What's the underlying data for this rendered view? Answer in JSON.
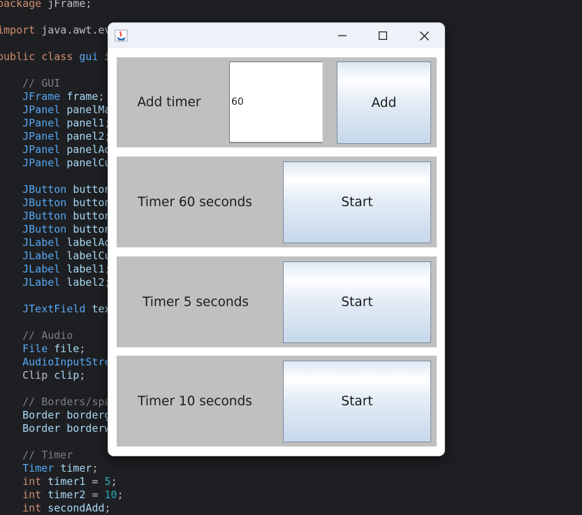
{
  "editor": {
    "lines": [
      [
        [
          "kw",
          "package"
        ],
        [
          "pl",
          " jFrame;"
        ]
      ],
      [],
      [
        [
          "kw",
          "import"
        ],
        [
          "pl",
          " java.awt.ev"
        ]
      ],
      [],
      [
        [
          "kw",
          "public class"
        ],
        [
          "pl",
          " "
        ],
        [
          "ty",
          "gui"
        ],
        [
          "pl",
          " i"
        ]
      ],
      [],
      [
        [
          "pl",
          "    "
        ],
        [
          "cm",
          "// GUI"
        ]
      ],
      [
        [
          "pl",
          "    "
        ],
        [
          "ty",
          "JFrame"
        ],
        [
          "pl",
          " "
        ],
        [
          "fd",
          "frame"
        ],
        [
          "pl",
          ";"
        ]
      ],
      [
        [
          "pl",
          "    "
        ],
        [
          "ty",
          "JPanel"
        ],
        [
          "pl",
          " "
        ],
        [
          "fd",
          "panelMa"
        ]
      ],
      [
        [
          "pl",
          "    "
        ],
        [
          "ty",
          "JPanel"
        ],
        [
          "pl",
          " "
        ],
        [
          "fd",
          "panel1"
        ],
        [
          "pl",
          ";"
        ]
      ],
      [
        [
          "pl",
          "    "
        ],
        [
          "ty",
          "JPanel"
        ],
        [
          "pl",
          " "
        ],
        [
          "fd",
          "panel2"
        ],
        [
          "pl",
          ";"
        ]
      ],
      [
        [
          "pl",
          "    "
        ],
        [
          "ty",
          "JPanel"
        ],
        [
          "pl",
          " "
        ],
        [
          "fd",
          "panelAd"
        ]
      ],
      [
        [
          "pl",
          "    "
        ],
        [
          "ty",
          "JPanel"
        ],
        [
          "pl",
          " "
        ],
        [
          "fd",
          "panelCu"
        ]
      ],
      [],
      [
        [
          "pl",
          "    "
        ],
        [
          "ty",
          "JButton"
        ],
        [
          "pl",
          " "
        ],
        [
          "fd",
          "button"
        ]
      ],
      [
        [
          "pl",
          "    "
        ],
        [
          "ty",
          "JButton"
        ],
        [
          "pl",
          " "
        ],
        [
          "fd",
          "button"
        ]
      ],
      [
        [
          "pl",
          "    "
        ],
        [
          "ty",
          "JButton"
        ],
        [
          "pl",
          " "
        ],
        [
          "fd",
          "button"
        ]
      ],
      [
        [
          "pl",
          "    "
        ],
        [
          "ty",
          "JButton"
        ],
        [
          "pl",
          " "
        ],
        [
          "fd",
          "button"
        ]
      ],
      [
        [
          "pl",
          "    "
        ],
        [
          "ty",
          "JLabel"
        ],
        [
          "pl",
          " "
        ],
        [
          "fd",
          "labelAd"
        ]
      ],
      [
        [
          "pl",
          "    "
        ],
        [
          "ty",
          "JLabel"
        ],
        [
          "pl",
          " "
        ],
        [
          "fd",
          "labelCu"
        ]
      ],
      [
        [
          "pl",
          "    "
        ],
        [
          "ty",
          "JLabel"
        ],
        [
          "pl",
          " "
        ],
        [
          "fd",
          "label1"
        ],
        [
          "pl",
          ";"
        ]
      ],
      [
        [
          "pl",
          "    "
        ],
        [
          "ty",
          "JLabel"
        ],
        [
          "pl",
          " "
        ],
        [
          "fd",
          "label2"
        ],
        [
          "pl",
          ";"
        ]
      ],
      [],
      [
        [
          "pl",
          "    "
        ],
        [
          "ty",
          "JTextField"
        ],
        [
          "pl",
          " "
        ],
        [
          "fd",
          "tex"
        ]
      ],
      [],
      [
        [
          "pl",
          "    "
        ],
        [
          "cm",
          "// Audio"
        ]
      ],
      [
        [
          "pl",
          "    "
        ],
        [
          "ty",
          "File"
        ],
        [
          "pl",
          " "
        ],
        [
          "fd",
          "file"
        ],
        [
          "pl",
          ";"
        ]
      ],
      [
        [
          "pl",
          "    "
        ],
        [
          "ty",
          "AudioInputStre"
        ]
      ],
      [
        [
          "pl",
          "    "
        ],
        [
          "pl",
          "Clip "
        ],
        [
          "fd",
          "clip"
        ],
        [
          "pl",
          ";"
        ]
      ],
      [],
      [
        [
          "pl",
          "    "
        ],
        [
          "cm",
          "// Borders/spa"
        ]
      ],
      [
        [
          "pl",
          "    "
        ],
        [
          "fd",
          "Border"
        ],
        [
          "pl",
          " "
        ],
        [
          "fd",
          "borderg"
        ]
      ],
      [
        [
          "pl",
          "    "
        ],
        [
          "fd",
          "Border"
        ],
        [
          "pl",
          " "
        ],
        [
          "fd",
          "borderw"
        ]
      ],
      [],
      [
        [
          "pl",
          "    "
        ],
        [
          "cm",
          "// Timer"
        ]
      ],
      [
        [
          "pl",
          "    "
        ],
        [
          "ty",
          "Timer"
        ],
        [
          "pl",
          " "
        ],
        [
          "fd",
          "timer"
        ],
        [
          "pl",
          ";"
        ]
      ],
      [
        [
          "pl",
          "    "
        ],
        [
          "kw",
          "int"
        ],
        [
          "pl",
          " "
        ],
        [
          "fd",
          "timer1"
        ],
        [
          "pl",
          " = "
        ],
        [
          "nm",
          "5"
        ],
        [
          "pl",
          ";"
        ]
      ],
      [
        [
          "pl",
          "    "
        ],
        [
          "kw",
          "int"
        ],
        [
          "pl",
          " "
        ],
        [
          "fd",
          "timer2"
        ],
        [
          "pl",
          " = "
        ],
        [
          "nm",
          "10"
        ],
        [
          "pl",
          ";"
        ]
      ],
      [
        [
          "pl",
          "    "
        ],
        [
          "kw",
          "int"
        ],
        [
          "pl",
          " "
        ],
        [
          "fd",
          "secondAdd"
        ],
        [
          "pl",
          ";"
        ]
      ]
    ]
  },
  "window": {
    "title": "",
    "controls": {
      "minimize": "minimize",
      "maximize": "maximize",
      "close": "close"
    },
    "add_row": {
      "label": "Add timer",
      "input_value": "60",
      "button_label": "Add"
    },
    "timers": [
      {
        "label": "Timer 60 seconds",
        "button_label": "Start"
      },
      {
        "label": "Timer 5 seconds",
        "button_label": "Start"
      },
      {
        "label": "Timer 10 seconds",
        "button_label": "Start"
      }
    ]
  },
  "colors": {
    "editor_bg": "#1e1f22",
    "panel_bg": "#c0c0c0",
    "titlebar_bg": "#eef2f8",
    "button_gradient_bottom": "#c6d8ea"
  },
  "icons": [
    "java-app-icon",
    "minimize-icon",
    "maximize-icon",
    "close-icon"
  ]
}
